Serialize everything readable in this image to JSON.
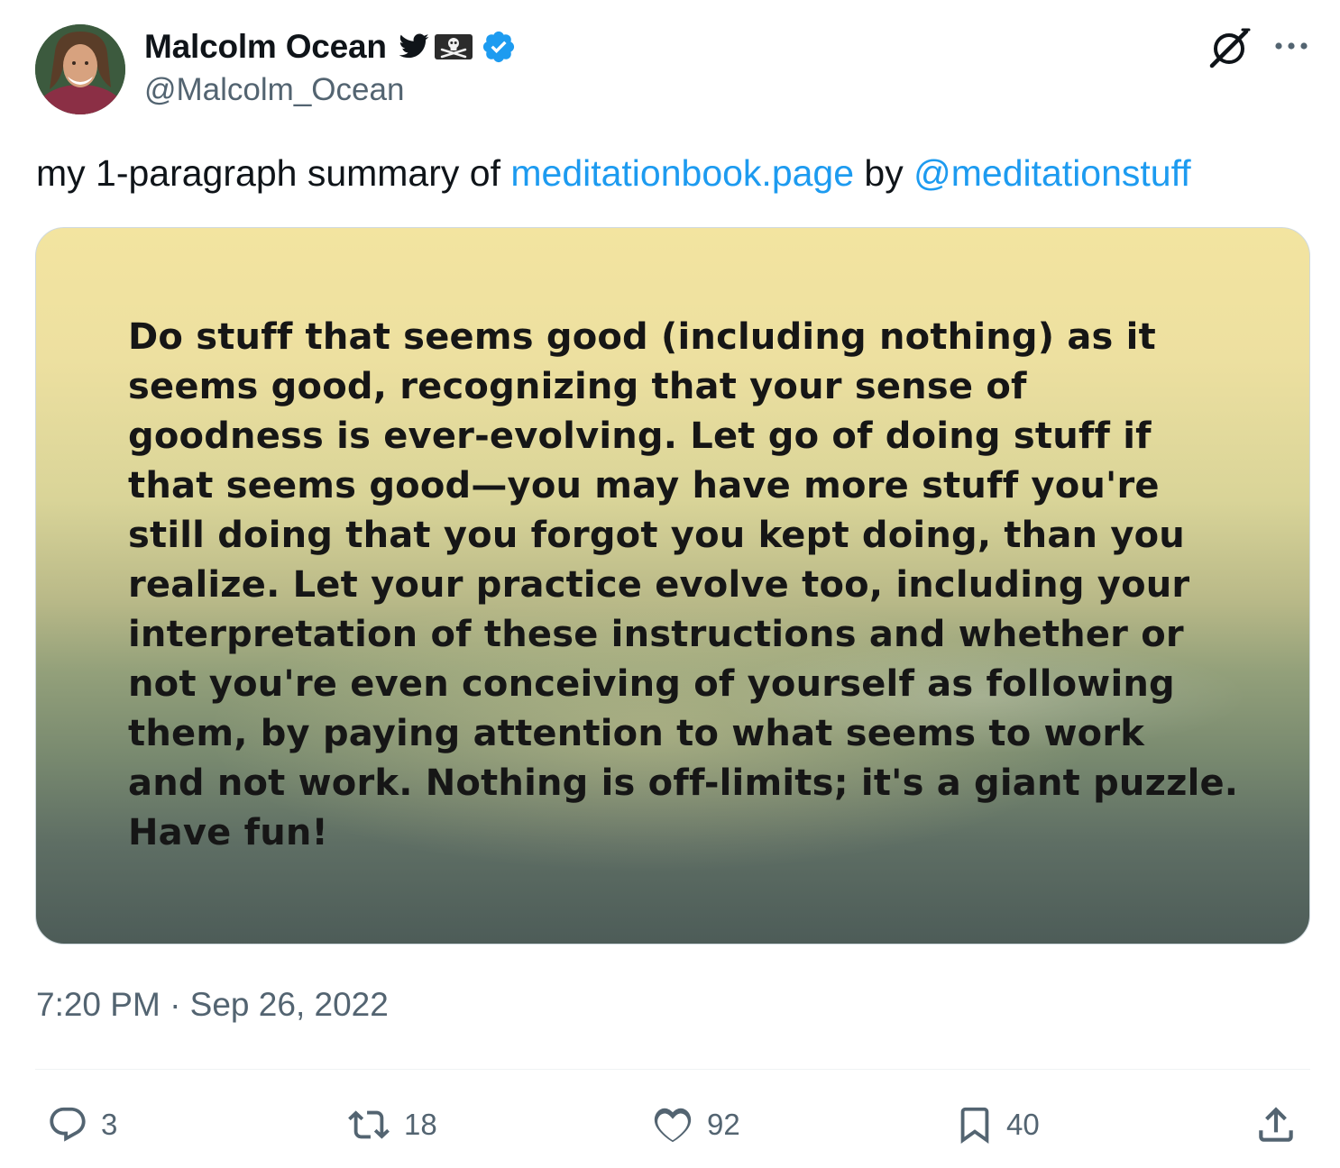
{
  "author": {
    "display_name": "Malcolm Ocean",
    "handle": "@Malcolm_Ocean",
    "badges": [
      "twitter-bird-icon",
      "pirate-flag-icon",
      "verified-badge-icon"
    ],
    "verified_color": "#1d9bf0"
  },
  "tweet": {
    "text_prefix": "my 1-paragraph summary of ",
    "link_text": "meditationbook.page",
    "text_middle": " by ",
    "mention_text": "@meditationstuff",
    "link_color": "#1d9bf0"
  },
  "media": {
    "quote_text": "Do stuff that seems good (including nothing) as it\nseems good, recognizing that your sense of\ngoodness is ever-evolving. Let go of doing stuff if\nthat seems good—you may have more stuff you're\nstill doing that you forgot you kept doing, than you\nrealize. Let your practice evolve too, including your\ninterpretation of these instructions and whether or\nnot you're even conceiving of yourself as following\nthem, by paying attention to what seems to work\nand not work. Nothing is off-limits; it's a giant puzzle.\nHave fun!"
  },
  "timestamp": "7:20 PM · Sep 26, 2022",
  "actions": {
    "replies": "3",
    "retweets": "18",
    "likes": "92",
    "bookmarks": "40"
  },
  "header_icons": [
    "grok-icon",
    "more-options-icon"
  ]
}
